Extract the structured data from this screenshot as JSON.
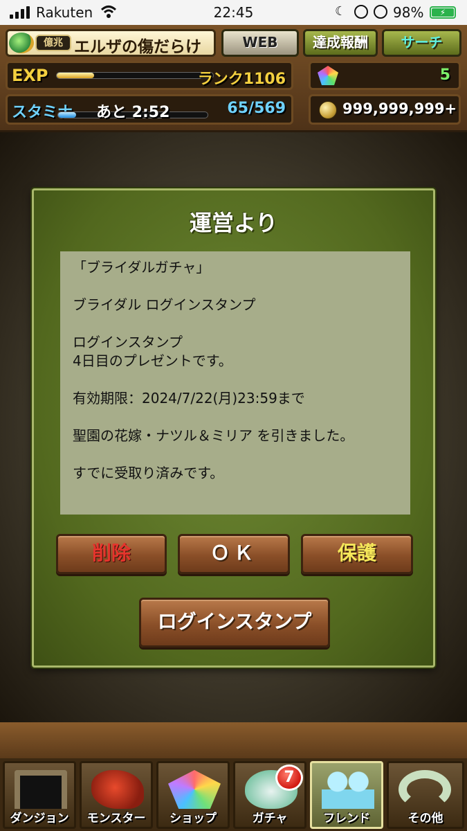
{
  "status_bar": {
    "carrier": "Rakuten",
    "time": "22:45",
    "battery_percent": "98%",
    "icons": [
      "signal-icon",
      "wifi-icon",
      "moon-icon",
      "rotation-lock-icon",
      "alarm-icon",
      "battery-icon"
    ]
  },
  "header": {
    "rank_badge": "億兆",
    "player_name": "エルザの傷だらけ",
    "buttons": {
      "web": "WEB",
      "achievements": "達成報酬",
      "search": "サーチ"
    },
    "exp_label": "EXP",
    "rank_text": "ランク1106",
    "exp_progress": 0.24,
    "stamina_label": "スタミナ",
    "stamina_timer": "あと 2:52",
    "stamina_value": "65/569",
    "stamina_progress": 0.12,
    "magic_stones": "5",
    "coins": "999,999,999+"
  },
  "dialog": {
    "title": "運営より",
    "message": [
      "「ブライダルガチャ」",
      "ブライダル ログインスタンプ",
      "ログインスタンプ\n4日目のプレゼントです。",
      "有効期限：2024/7/22(月)23:59まで",
      "聖園の花嫁・ナツル＆ミリア を引きました。",
      "すでに受取り済みです。"
    ],
    "buttons": {
      "delete": "削除",
      "ok": "ＯＫ",
      "protect": "保護",
      "login_stamp": "ログインスタンプ"
    }
  },
  "nav": {
    "items": [
      {
        "label": "ダンジョン",
        "icon": "dungeon-gate-icon"
      },
      {
        "label": "モンスター",
        "icon": "dragon-icon"
      },
      {
        "label": "ショップ",
        "icon": "rainbow-gem-icon"
      },
      {
        "label": "ガチャ",
        "icon": "egg-icon"
      },
      {
        "label": "フレンド",
        "icon": "friends-icon"
      },
      {
        "label": "その他",
        "icon": "question-mark-icon"
      }
    ],
    "gacha_badge": "7",
    "active": "フレンド"
  },
  "colors": {
    "dialog_green": "#52681e",
    "message_bg": "#a7ad8a",
    "button_brown": "#8a4f28",
    "delete_red": "#e5342c",
    "protect_yellow": "#f6e85a"
  }
}
